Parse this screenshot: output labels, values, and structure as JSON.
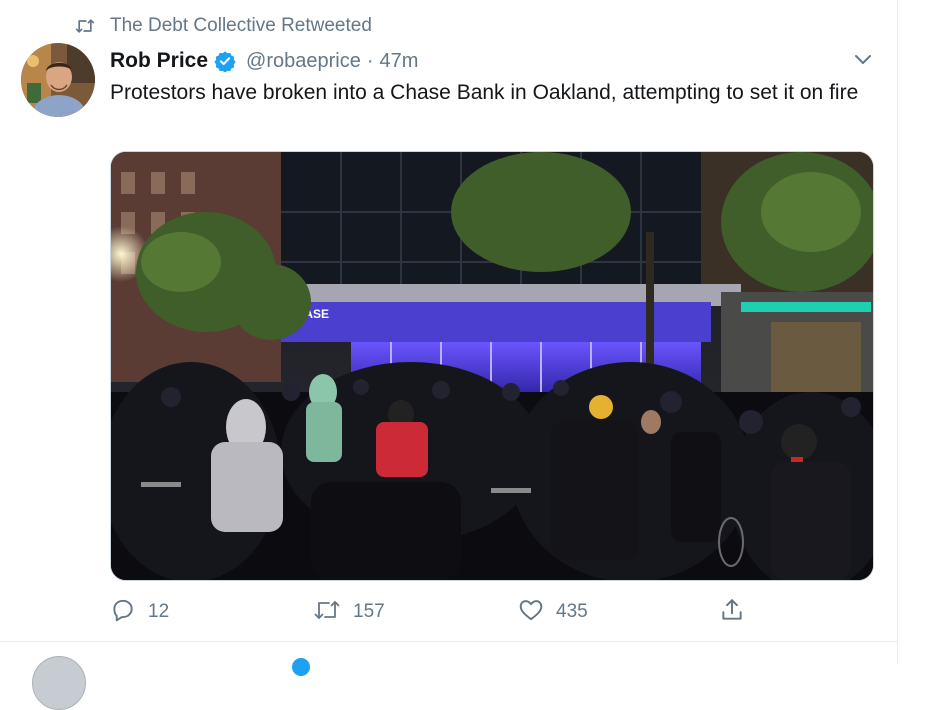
{
  "retweet_context": {
    "label": "The Debt Collective Retweeted",
    "icon": "retweet-icon"
  },
  "tweet": {
    "author_name": "Rob Price",
    "verified": true,
    "handle": "@robaeprice",
    "separator": "·",
    "time": "47m",
    "text": "Protestors have broken into a Chase Bank in Oakland, attempting to set it on fire",
    "media": {
      "sign_text": "CHASE",
      "description_icon": "photo"
    },
    "actions": {
      "reply_count": "12",
      "retweet_count": "157",
      "like_count": "435"
    }
  },
  "colors": {
    "accent": "#1da1f2",
    "muted_text": "#657786",
    "primary_text": "#14171a",
    "divider": "#e6ecf0"
  },
  "icons": [
    "retweet-icon",
    "avatar",
    "verified-badge-icon",
    "chevron-down-icon",
    "reply-icon",
    "retweet-action-icon",
    "like-icon",
    "share-icon"
  ]
}
